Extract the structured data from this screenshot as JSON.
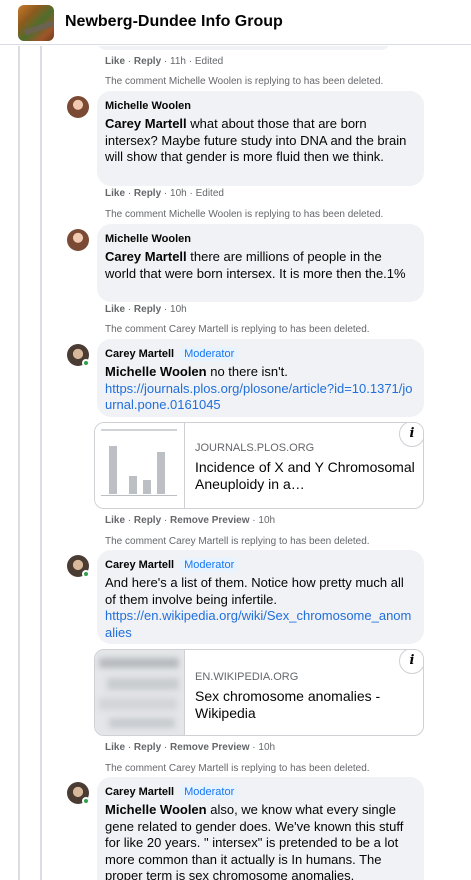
{
  "header": {
    "group_name": "Newberg-Dundee Info Group"
  },
  "top_actions": {
    "like": "Like",
    "reply": "Reply",
    "meta": "11h · Edited"
  },
  "comments": [
    {
      "deleted_notice": "The comment Michelle Woolen is replying to has been deleted.",
      "author": "Michelle Woolen",
      "badge": "",
      "mention": "Carey Martell",
      "text": " what about those that are born intersex? Maybe future study into DNA and the brain will show that gender is more fluid then we think.",
      "actions": {
        "like": "Like",
        "reply": "Reply",
        "meta": "10h · Edited"
      }
    },
    {
      "deleted_notice": "The comment Michelle Woolen is replying to has been deleted.",
      "author": "Michelle Woolen",
      "badge": "",
      "mention": "Carey Martell",
      "text": " there are millions of people in the world that were born intersex. It is more then the.1%",
      "actions": {
        "like": "Like",
        "reply": "Reply",
        "meta": "10h"
      }
    },
    {
      "deleted_notice": "The comment Carey Martell is replying to has been deleted.",
      "author": "Carey Martell",
      "badge": "Moderator",
      "mention": "Michelle Woolen",
      "text": " no there isn't.",
      "link": "https://journals.plos.org/plosone/article?id=10.1371/journal.pone.0161045",
      "preview": {
        "domain": "JOURNALS.PLOS.ORG",
        "title": "Incidence of X and Y Chromosomal Aneuploidy in a…"
      },
      "actions": {
        "like": "Like",
        "reply": "Reply",
        "remove": "Remove Preview",
        "meta": "10h"
      }
    },
    {
      "deleted_notice": "The comment Carey Martell is replying to has been deleted.",
      "author": "Carey Martell",
      "badge": "Moderator",
      "text": "And here's a list of them. Notice how pretty much all of them involve being infertile.",
      "link": "https://en.wikipedia.org/wiki/Sex_chromosome_anomalies",
      "preview": {
        "domain": "EN.WIKIPEDIA.ORG",
        "title": "Sex chromosome anomalies - Wikipedia"
      },
      "actions": {
        "like": "Like",
        "reply": "Reply",
        "remove": "Remove Preview",
        "meta": "10h"
      }
    },
    {
      "deleted_notice": "The comment Carey Martell is replying to has been deleted.",
      "author": "Carey Martell",
      "badge": "Moderator",
      "mention": "Michelle Woolen",
      "text": " also, we know what every single gene related to gender does. We've known this stuff for like 20 years. \" intersex\" is pretended to be a lot more common than it actually is In humans. The proper term is sex chromosome anomalies."
    }
  ],
  "icons": {
    "info": "i"
  },
  "colors": {
    "link": "#216fdb",
    "moderator_badge": "#1877f2",
    "bubble": "#f0f2f5",
    "online": "#31a24c"
  }
}
